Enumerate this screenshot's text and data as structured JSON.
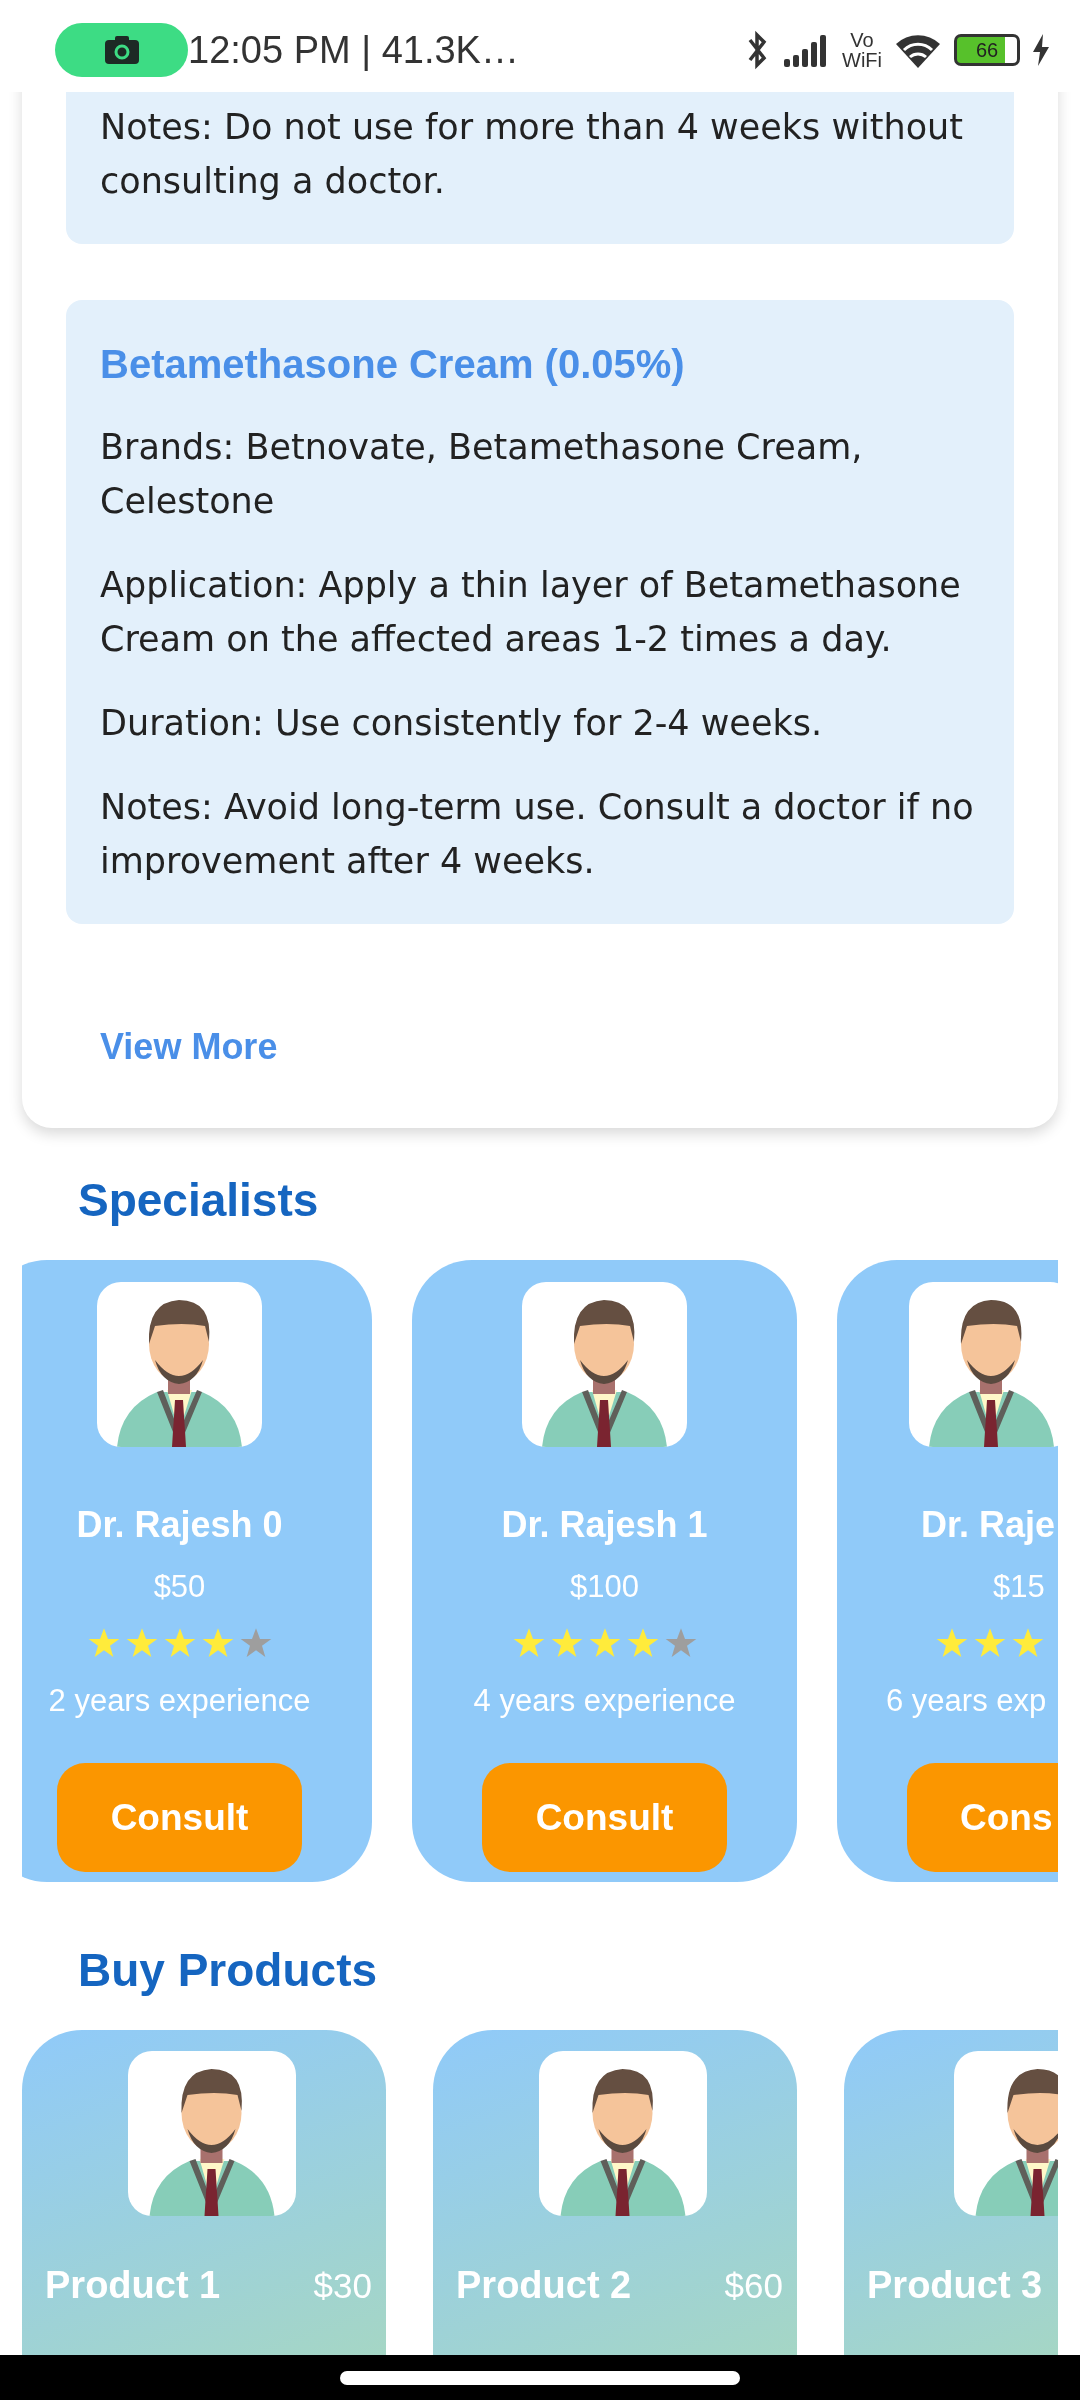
{
  "status_bar": {
    "time": "12:05 PM | 41.3K…",
    "network_top": "Vo",
    "network_bottom": "WiFi",
    "battery": "66"
  },
  "medicines": [
    {
      "lines": [
        "Notes: Do not use for more than 4 weeks without consulting a doctor."
      ]
    },
    {
      "title": "Betamethasone Cream (0.05%)",
      "lines": [
        "Brands: Betnovate, Betamethasone Cream, Celestone",
        "Application: Apply a thin layer of Betamethasone Cream on the affected areas 1-2 times a day.",
        "Duration: Use consistently for 2-4 weeks.",
        "Notes: Avoid long-term use. Consult a doctor if no improvement after 4 weeks."
      ]
    }
  ],
  "view_more": "View More",
  "specialists": {
    "heading": "Specialists",
    "items": [
      {
        "name": "Dr. Rajesh 0",
        "price": "$50",
        "stars": 4,
        "experience": "2 years experience",
        "button": "Consult",
        "clipped": false
      },
      {
        "name": "Dr. Rajesh 1",
        "price": "$100",
        "stars": 4,
        "experience": "4 years experience",
        "button": "Consult",
        "clipped": false
      },
      {
        "name": "Dr. Raje",
        "price": "$15",
        "stars": 3,
        "experience": "6 years exp",
        "button": "Cons",
        "clipped": true
      }
    ]
  },
  "products": {
    "heading": "Buy Products",
    "items": [
      {
        "name": "Product 1",
        "price": "$30",
        "clipped": false
      },
      {
        "name": "Product 2",
        "price": "$60",
        "clipped": false
      },
      {
        "name": "Product 3",
        "clipped": true
      }
    ]
  }
}
